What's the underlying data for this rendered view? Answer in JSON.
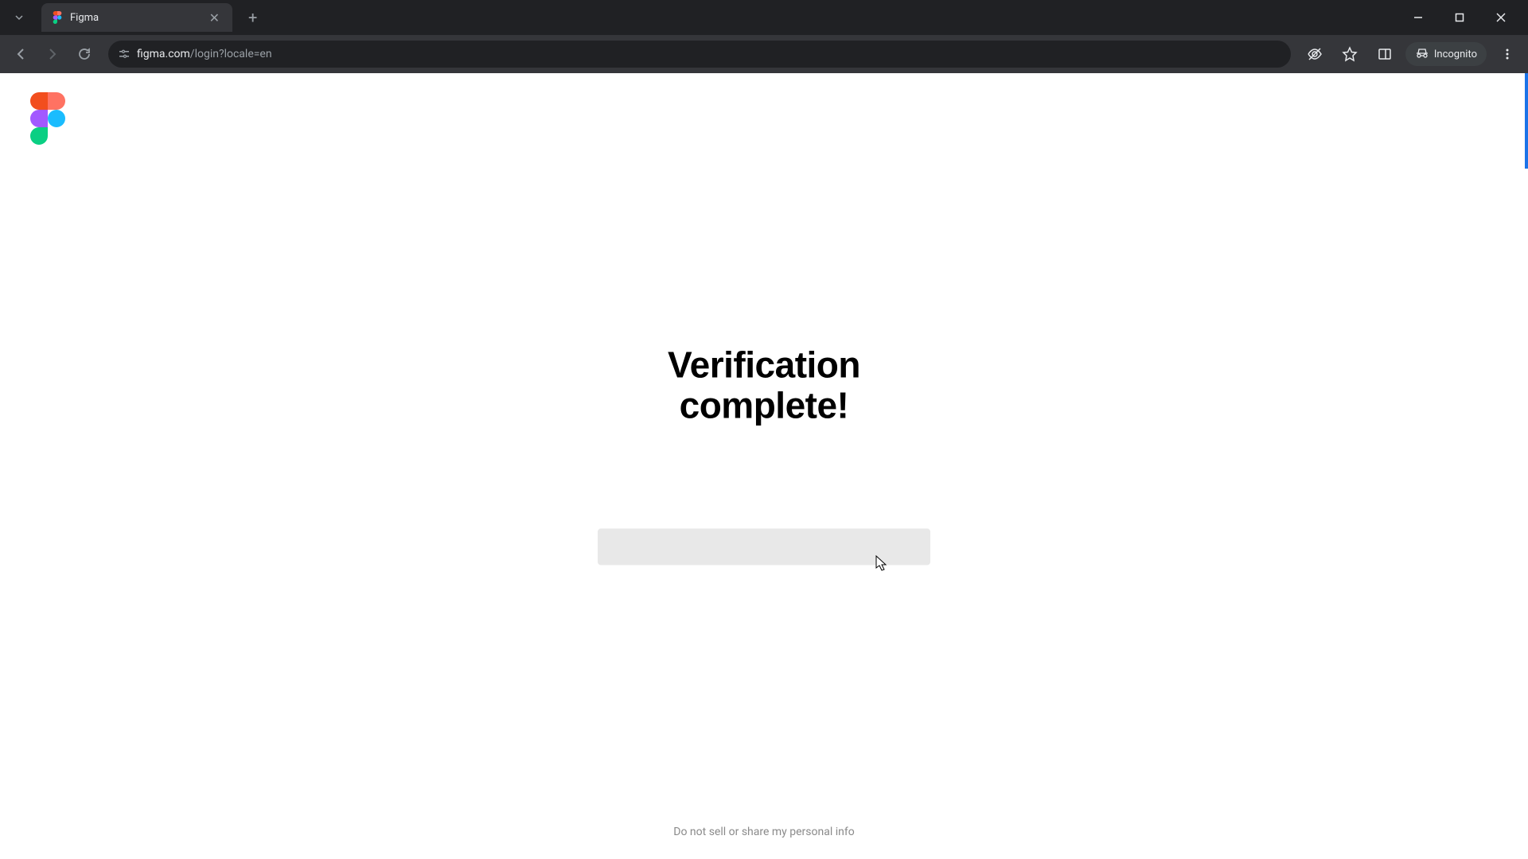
{
  "browser": {
    "tab_title": "Figma",
    "url_domain": "figma.com",
    "url_path": "/login?locale=en",
    "incognito_label": "Incognito"
  },
  "page": {
    "heading_line1": "Verification",
    "heading_line2": "complete!",
    "footer_link": "Do not sell or share my personal info"
  }
}
